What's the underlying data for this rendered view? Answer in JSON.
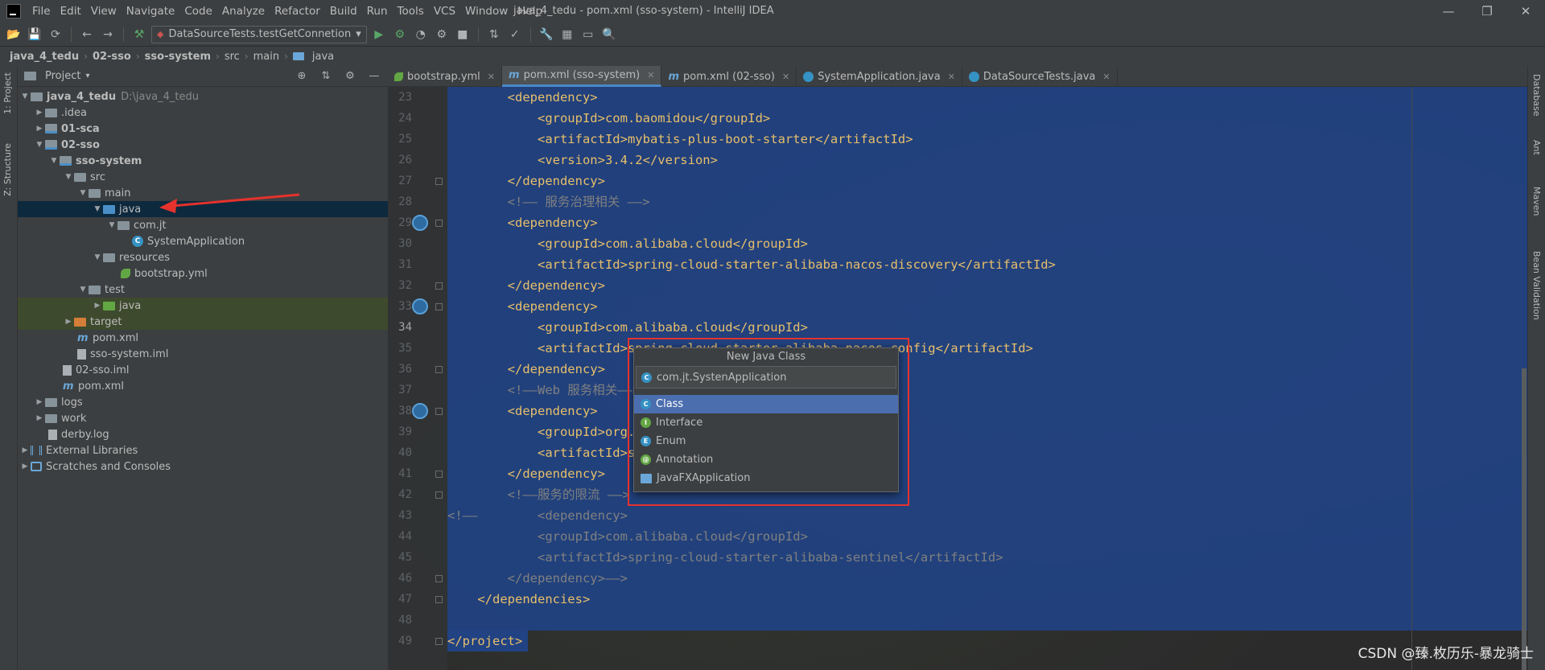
{
  "menubar": {
    "items": [
      "File",
      "Edit",
      "View",
      "Navigate",
      "Code",
      "Analyze",
      "Refactor",
      "Build",
      "Run",
      "Tools",
      "VCS",
      "Window",
      "Help"
    ],
    "window_title": "java_4_tedu - pom.xml (sso-system) - IntelliJ IDEA",
    "minimize": "—",
    "restore": "❐",
    "close": "✕"
  },
  "toolbar": {
    "run_config": "DataSourceTests.testGetConnetion"
  },
  "breadcrumb": [
    "java_4_tedu",
    "02-sso",
    "sso-system",
    "src",
    "main",
    "java"
  ],
  "left_stripe": {
    "project": "1: Project",
    "structure": "Z: Structure"
  },
  "right_stripe": {
    "database": "Database",
    "ant": "Ant",
    "maven": "Maven",
    "bean_validation": "Bean Validation"
  },
  "project_panel": {
    "title": "Project",
    "tree": [
      {
        "label": "java_4_tedu",
        "hint": "D:\\java_4_tedu",
        "bold": true
      },
      {
        "label": ".idea"
      },
      {
        "label": "01-sca",
        "bold": true
      },
      {
        "label": "02-sso",
        "bold": true
      },
      {
        "label": "sso-system",
        "bold": true
      },
      {
        "label": "src"
      },
      {
        "label": "main"
      },
      {
        "label": "java"
      },
      {
        "label": "com.jt"
      },
      {
        "label": "SystemApplication"
      },
      {
        "label": "resources"
      },
      {
        "label": "bootstrap.yml"
      },
      {
        "label": "test"
      },
      {
        "label": "java"
      },
      {
        "label": "target"
      },
      {
        "label": "pom.xml"
      },
      {
        "label": "sso-system.iml"
      },
      {
        "label": "02-sso.iml"
      },
      {
        "label": "pom.xml"
      },
      {
        "label": "logs"
      },
      {
        "label": "work"
      },
      {
        "label": "derby.log"
      },
      {
        "label": "External Libraries"
      },
      {
        "label": "Scratches and Consoles"
      }
    ]
  },
  "editor_tabs": [
    {
      "label": "bootstrap.yml"
    },
    {
      "label": "pom.xml (sso-system)"
    },
    {
      "label": "pom.xml (02-sso)"
    },
    {
      "label": "SystemApplication.java"
    },
    {
      "label": "DataSourceTests.java"
    }
  ],
  "editor": {
    "lines": [
      {
        "num": "23",
        "text": "        <dependency>"
      },
      {
        "num": "24",
        "text": "            <groupId>com.baomidou</groupId>"
      },
      {
        "num": "25",
        "text": "            <artifactId>mybatis-plus-boot-starter</artifactId>"
      },
      {
        "num": "26",
        "text": "            <version>3.4.2</version>"
      },
      {
        "num": "27",
        "text": "        </dependency>"
      },
      {
        "num": "28",
        "text": "        <!—— 服务治理相关 ——>"
      },
      {
        "num": "29",
        "text": "        <dependency>"
      },
      {
        "num": "30",
        "text": "            <groupId>com.alibaba.cloud</groupId>"
      },
      {
        "num": "31",
        "text": "            <artifactId>spring-cloud-starter-alibaba-nacos-discovery</artifactId>"
      },
      {
        "num": "32",
        "text": "        </dependency>"
      },
      {
        "num": "33",
        "text": "        <dependency>"
      },
      {
        "num": "34",
        "text": "            <groupId>com.alibaba.cloud</groupId>"
      },
      {
        "num": "35",
        "text": "            <artifactId>spring-cloud-starter-alibaba-nacos-config</artifactId>"
      },
      {
        "num": "36",
        "text": "        </dependency>"
      },
      {
        "num": "37",
        "text": "        <!——Web 服务相关——>"
      },
      {
        "num": "38",
        "text": "        <dependency>"
      },
      {
        "num": "39",
        "text": "            <groupId>org.springframework.boot</groupId>"
      },
      {
        "num": "40",
        "text": "            <artifactId>spring-boot-starter-web</artifactId>"
      },
      {
        "num": "41",
        "text": "        </dependency>"
      },
      {
        "num": "42",
        "text": "        <!——服务的限流 ——>"
      },
      {
        "num": "43",
        "text": "<!——        <dependency>"
      },
      {
        "num": "44",
        "text": "            <groupId>com.alibaba.cloud</groupId>"
      },
      {
        "num": "45",
        "text": "            <artifactId>spring-cloud-starter-alibaba-sentinel</artifactId>"
      },
      {
        "num": "46",
        "text": "        </dependency>——>"
      },
      {
        "num": "47",
        "text": "    </dependencies>"
      },
      {
        "num": "48",
        "text": ""
      },
      {
        "num": "49",
        "text": "</project>"
      }
    ]
  },
  "popup": {
    "title": "New Java Class",
    "input_value": "com.jt.SystenApplication",
    "options": [
      "Class",
      "Interface",
      "Enum",
      "Annotation",
      "JavaFXApplication"
    ],
    "selected": "Class"
  },
  "watermark": "CSDN @臻.枚历乐-暴龙骑士",
  "colors": {
    "selection": "#214283",
    "tag": "#e8bf6a",
    "comment": "#808080",
    "annotation_red": "#e5322d"
  }
}
